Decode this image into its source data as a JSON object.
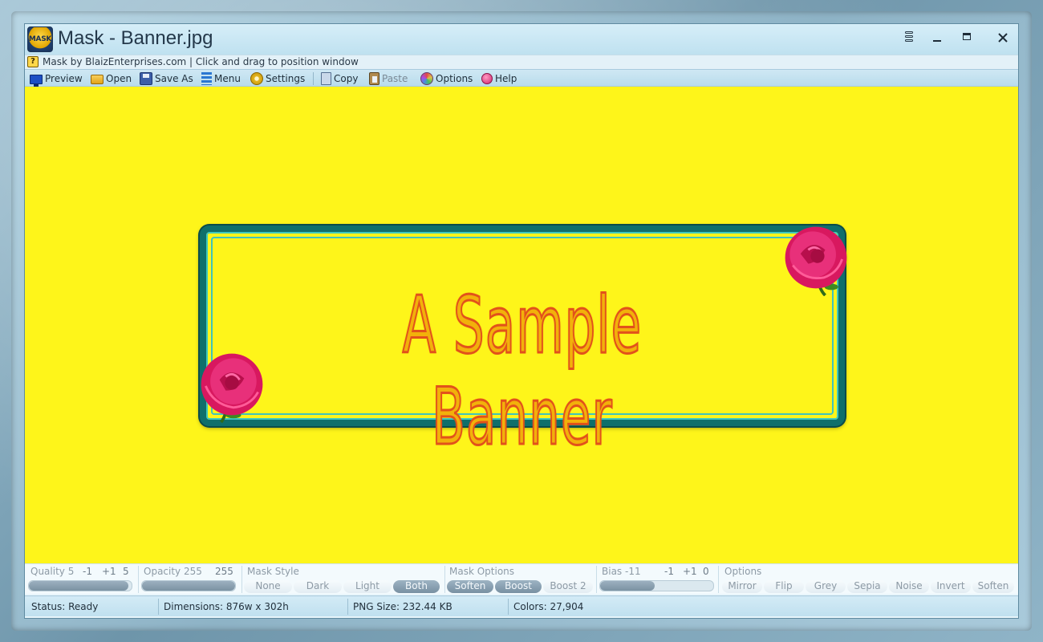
{
  "window": {
    "title": "Mask - Banner.jpg",
    "icon_label": "MASK",
    "info_text": "Mask by BlaizEnterprises.com | Click and drag to position window"
  },
  "toolbar": {
    "items": [
      {
        "label": "Preview",
        "icon": "monitor-icon"
      },
      {
        "label": "Open",
        "icon": "folder-open-icon"
      },
      {
        "label": "Save As",
        "icon": "floppy-disk-icon"
      },
      {
        "label": "Menu",
        "icon": "menu-lines-icon"
      },
      {
        "label": "Settings",
        "icon": "gear-icon"
      },
      {
        "label": "Copy",
        "icon": "copy-icon"
      },
      {
        "label": "Paste",
        "icon": "clipboard-icon",
        "disabled": true
      },
      {
        "label": "Options",
        "icon": "palette-icon"
      },
      {
        "label": "Help",
        "icon": "help-balloon-icon"
      }
    ]
  },
  "canvas": {
    "background": "#fef51a",
    "banner_text": "A Sample Banner"
  },
  "controls": {
    "quality": {
      "label": "Quality 5",
      "minus": "-1",
      "plus": "+1",
      "value": "5",
      "level": 0.97
    },
    "opacity": {
      "label": "Opacity 255",
      "value": "255",
      "level": 1.0
    },
    "mask_style": {
      "label": "Mask Style",
      "options": [
        "None",
        "Dark",
        "Light",
        "Both"
      ],
      "selected": "Both"
    },
    "mask_options": {
      "label": "Mask Options",
      "options": [
        "Soften",
        "Boost",
        "Boost 2"
      ],
      "active": [
        "Soften",
        "Boost"
      ]
    },
    "bias": {
      "label": "Bias -11",
      "minus": "-1",
      "plus": "+1",
      "value": "0",
      "level": 0.48
    },
    "options": {
      "label": "Options",
      "items": [
        "Mirror",
        "Flip",
        "Grey",
        "Sepia",
        "Noise",
        "Invert",
        "Soften"
      ]
    }
  },
  "status": {
    "status": "Status: Ready",
    "dimensions": "Dimensions: 876w x 302h",
    "png_size": "PNG Size: 232.44 KB",
    "colors": "Colors: 27,904"
  }
}
